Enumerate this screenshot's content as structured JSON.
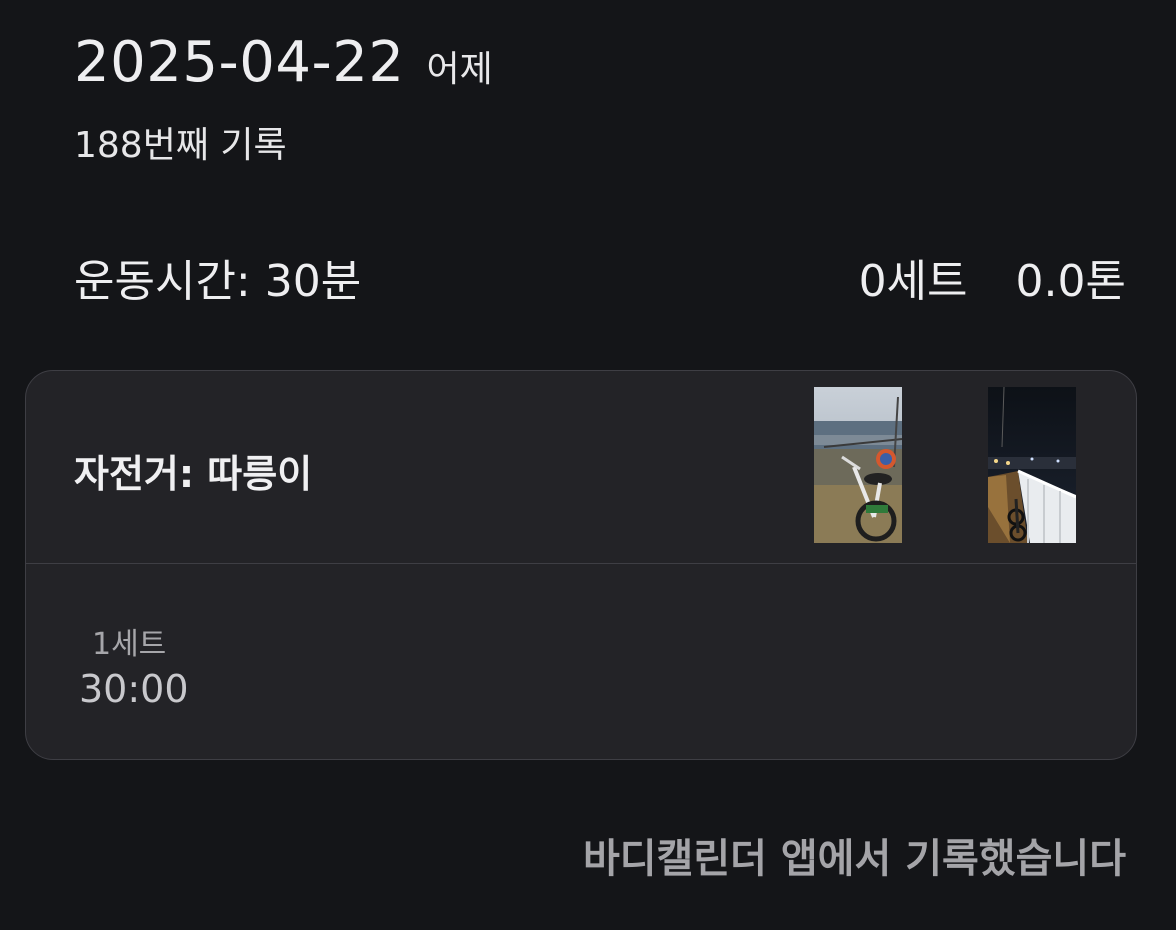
{
  "header": {
    "date": "2025-04-22",
    "relative_day": "어제",
    "record_count": "188번째 기록"
  },
  "summary": {
    "duration": "운동시간: 30분",
    "sets": "0세트",
    "volume": "0.0톤"
  },
  "exercise": {
    "name": "자전거: 따릉이",
    "photos": [
      "bicycle-by-river-photo",
      "night-bridge-bicycle-photo"
    ],
    "sets": [
      {
        "label": "1세트",
        "value": "30:00"
      }
    ]
  },
  "footer": {
    "note": "바디캘린더 앱에서 기록했습니다"
  },
  "colors": {
    "background": "#141518",
    "card": "#232327",
    "card_border": "#3e3e44",
    "muted_text": "#a4a4a8"
  }
}
